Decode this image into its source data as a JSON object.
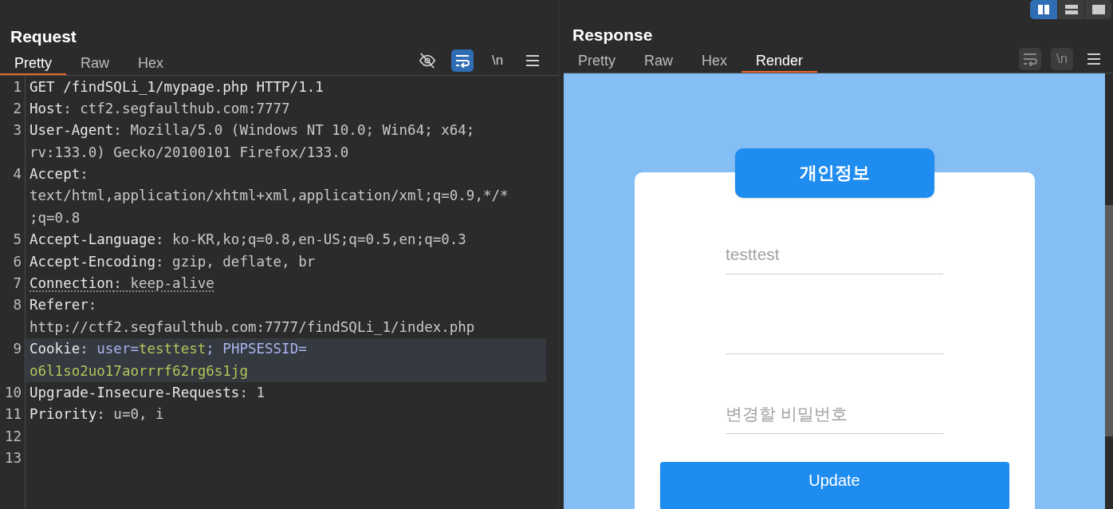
{
  "layout_buttons": [
    {
      "kind": "columns",
      "selected": true
    },
    {
      "kind": "rows",
      "selected": false
    },
    {
      "kind": "single",
      "selected": false
    }
  ],
  "request": {
    "title": "Request",
    "tabs": [
      {
        "label": "Pretty",
        "selected": true
      },
      {
        "label": "Raw",
        "selected": false
      },
      {
        "label": "Hex",
        "selected": false
      }
    ],
    "tools": [
      {
        "kind": "hide",
        "on": false
      },
      {
        "kind": "wrap",
        "on": true
      },
      {
        "kind": "newline",
        "on": false,
        "label": "\\n"
      },
      {
        "kind": "menu",
        "on": false
      }
    ],
    "lines": [
      {
        "number": "1",
        "highlighted": false,
        "underlined": false,
        "rows": [
          [
            {
              "text": "GET /findSQLi_1/mypage.php HTTP/1.1",
              "kind": "key"
            }
          ]
        ]
      },
      {
        "number": "2",
        "highlighted": false,
        "underlined": false,
        "rows": [
          [
            {
              "text": "Host",
              "kind": "key"
            },
            {
              "text": ": ctf2.segfaulthub.com:7777",
              "kind": "value"
            }
          ]
        ]
      },
      {
        "number": "3",
        "highlighted": false,
        "underlined": false,
        "rows": [
          [
            {
              "text": "User-Agent",
              "kind": "key"
            },
            {
              "text": ": Mozilla/5.0 (Windows NT 10.0; Win64; x64;",
              "kind": "value"
            }
          ],
          [
            {
              "text": "rv:133.0) Gecko/20100101 Firefox/133.0",
              "kind": "value"
            }
          ]
        ]
      },
      {
        "number": "4",
        "highlighted": false,
        "underlined": false,
        "rows": [
          [
            {
              "text": "Accept",
              "kind": "key"
            },
            {
              "text": ":",
              "kind": "value"
            }
          ],
          [
            {
              "text": "text/html,application/xhtml+xml,application/xml;q=0.9,*/*",
              "kind": "value"
            }
          ],
          [
            {
              "text": ";q=0.8",
              "kind": "value"
            }
          ]
        ]
      },
      {
        "number": "5",
        "highlighted": false,
        "underlined": false,
        "rows": [
          [
            {
              "text": "Accept-Language",
              "kind": "key"
            },
            {
              "text": ": ko-KR,ko;q=0.8,en-US;q=0.5,en;q=0.3",
              "kind": "value"
            }
          ]
        ]
      },
      {
        "number": "6",
        "highlighted": false,
        "underlined": false,
        "rows": [
          [
            {
              "text": "Accept-Encoding",
              "kind": "key"
            },
            {
              "text": ": gzip, deflate, br",
              "kind": "value"
            }
          ]
        ]
      },
      {
        "number": "7",
        "highlighted": false,
        "underlined": true,
        "rows": [
          [
            {
              "text": "Connection",
              "kind": "key"
            },
            {
              "text": ": keep-alive",
              "kind": "value"
            }
          ]
        ]
      },
      {
        "number": "8",
        "highlighted": false,
        "underlined": false,
        "rows": [
          [
            {
              "text": "Referer",
              "kind": "key"
            },
            {
              "text": ":",
              "kind": "value"
            }
          ],
          [
            {
              "text": "http://ctf2.segfaulthub.com:7777/findSQLi_1/index.php",
              "kind": "value"
            }
          ]
        ]
      },
      {
        "number": "9",
        "highlighted": true,
        "underlined": false,
        "rows": [
          [
            {
              "text": "Cookie",
              "kind": "key"
            },
            {
              "text": ": ",
              "kind": "value"
            },
            {
              "text": "user=",
              "kind": "cookie_name"
            },
            {
              "text": "testtest",
              "kind": "cookie_value"
            },
            {
              "text": "; PHPSESSID=",
              "kind": "cookie_name"
            }
          ],
          [
            {
              "text": "o6l1so2uo17aorrrf62rg6s1jg",
              "kind": "cookie_value"
            }
          ]
        ]
      },
      {
        "number": "10",
        "highlighted": false,
        "underlined": false,
        "rows": [
          [
            {
              "text": "Upgrade-Insecure-Requests",
              "kind": "key"
            },
            {
              "text": ": 1",
              "kind": "value"
            }
          ]
        ]
      },
      {
        "number": "11",
        "highlighted": false,
        "underlined": false,
        "rows": [
          [
            {
              "text": "Priority",
              "kind": "key"
            },
            {
              "text": ": u=0, i",
              "kind": "value"
            }
          ]
        ]
      },
      {
        "number": "12"
      },
      {
        "number": "13"
      }
    ]
  },
  "response": {
    "title": "Response",
    "tabs": [
      {
        "label": "Pretty",
        "selected": false
      },
      {
        "label": "Raw",
        "selected": false
      },
      {
        "label": "Hex",
        "selected": false
      },
      {
        "label": "Render",
        "selected": true
      }
    ],
    "tools": [
      {
        "kind": "wrap",
        "on": false
      },
      {
        "kind": "newline",
        "on": false,
        "label": "\\n"
      },
      {
        "kind": "menu",
        "on": false
      }
    ],
    "render": {
      "heading": "개인정보",
      "fields": [
        {
          "kind": "line",
          "placeholder": "testtest"
        },
        {
          "kind": "line"
        },
        {
          "kind": "line",
          "placeholder": "변경할 비밀번호"
        }
      ],
      "button": "Update"
    }
  }
}
